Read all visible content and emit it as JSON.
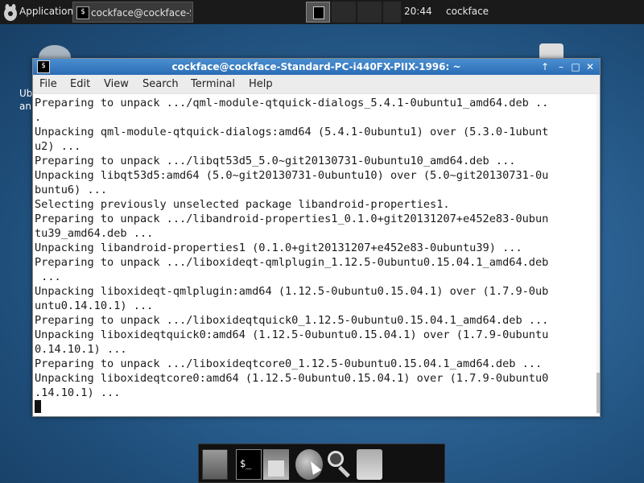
{
  "top_panel": {
    "applications_label": "Applications",
    "task_label": "cockface@cockface-Sta...",
    "task_icon": "terminal-icon",
    "clock": "20:44",
    "user": "cockface"
  },
  "desktop": {
    "left_icon_text": "Ub\nan"
  },
  "window": {
    "title": "cockface@cockface-Standard-PC-i440FX-PIIX-1996: ~",
    "buttons": {
      "up": "↑",
      "minimize": "–",
      "maximize": "□",
      "close": "✕"
    },
    "menu": {
      "file": "File",
      "edit": "Edit",
      "view": "View",
      "search": "Search",
      "terminal": "Terminal",
      "help": "Help"
    },
    "terminal_lines": [
      "Preparing to unpack .../qml-module-qtquick-dialogs_5.4.1-0ubuntu1_amd64.deb ..",
      ".",
      "Unpacking qml-module-qtquick-dialogs:amd64 (5.4.1-0ubuntu1) over (5.3.0-1ubunt",
      "u2) ...",
      "Preparing to unpack .../libqt53d5_5.0~git20130731-0ubuntu10_amd64.deb ...",
      "Unpacking libqt53d5:amd64 (5.0~git20130731-0ubuntu10) over (5.0~git20130731-0u",
      "buntu6) ...",
      "Selecting previously unselected package libandroid-properties1.",
      "Preparing to unpack .../libandroid-properties1_0.1.0+git20131207+e452e83-0ubun",
      "tu39_amd64.deb ...",
      "Unpacking libandroid-properties1 (0.1.0+git20131207+e452e83-0ubuntu39) ...",
      "Preparing to unpack .../liboxideqt-qmlplugin_1.12.5-0ubuntu0.15.04.1_amd64.deb",
      " ...",
      "Unpacking liboxideqt-qmlplugin:amd64 (1.12.5-0ubuntu0.15.04.1) over (1.7.9-0ub",
      "untu0.14.10.1) ...",
      "Preparing to unpack .../liboxideqtquick0_1.12.5-0ubuntu0.15.04.1_amd64.deb ...",
      "Unpacking liboxideqtquick0:amd64 (1.12.5-0ubuntu0.15.04.1) over (1.7.9-0ubuntu",
      "0.14.10.1) ...",
      "Preparing to unpack .../liboxideqtcore0_1.12.5-0ubuntu0.15.04.1_amd64.deb ...",
      "Unpacking liboxideqtcore0:amd64 (1.12.5-0ubuntu0.15.04.1) over (1.7.9-0ubuntu0",
      ".14.10.1) ..."
    ]
  },
  "dock": {
    "items": [
      "show-desktop-icon",
      "terminal-icon",
      "home-folder-icon",
      "web-browser-icon",
      "search-icon",
      "files-icon"
    ],
    "terminal_glyph": "$_"
  }
}
